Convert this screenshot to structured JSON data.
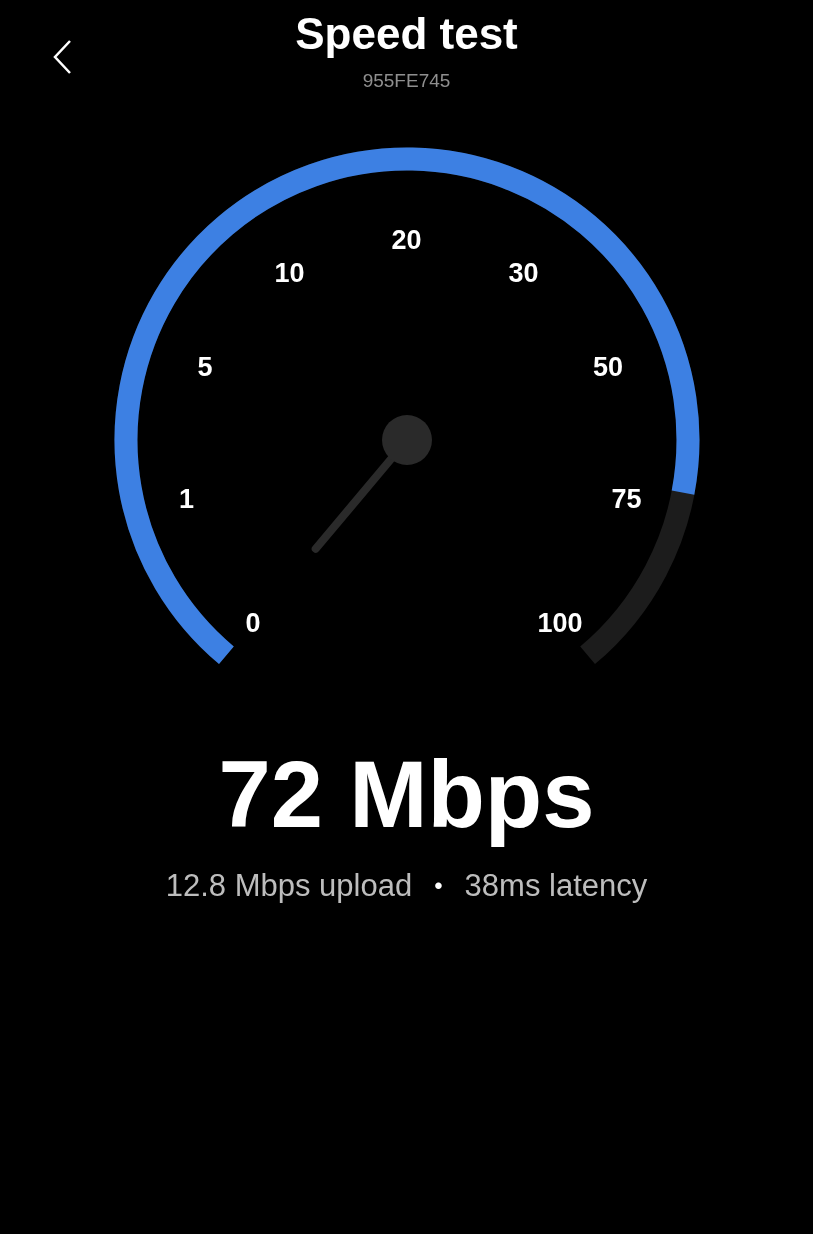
{
  "header": {
    "title": "Speed test",
    "subtitle": "955FE745"
  },
  "gauge": {
    "scale_labels": [
      "0",
      "1",
      "5",
      "10",
      "20",
      "30",
      "50",
      "75",
      "100"
    ]
  },
  "result": {
    "speed": "72 Mbps",
    "upload": "12.8 Mbps upload",
    "separator": "•",
    "latency": "38ms latency"
  }
}
